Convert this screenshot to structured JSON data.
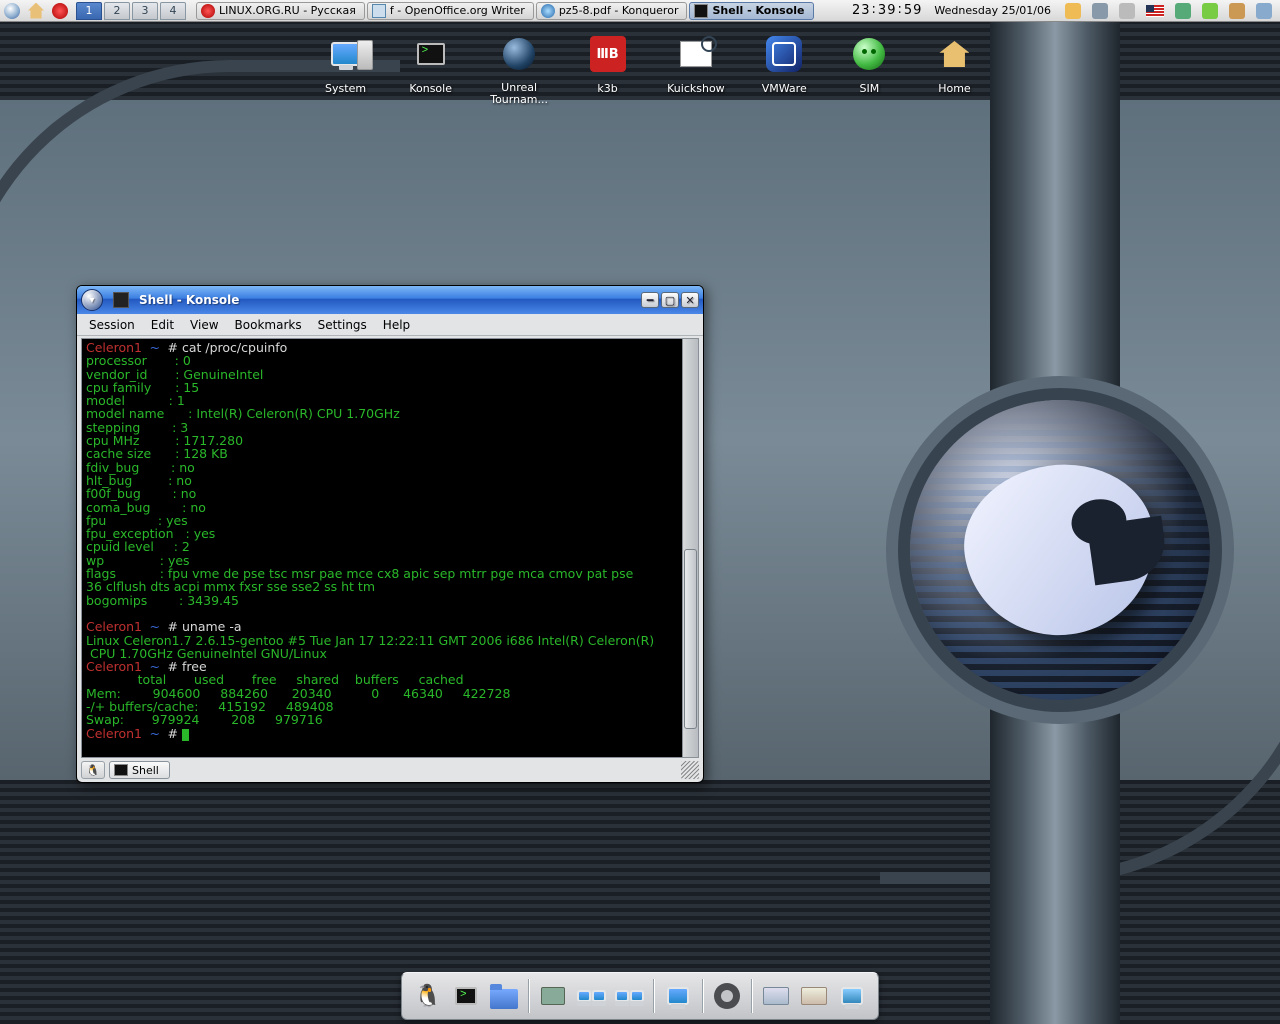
{
  "taskbar": {
    "desktops": [
      "1",
      "2",
      "3",
      "4"
    ],
    "active_desktop": 0,
    "tasks": [
      {
        "label": "LINUX.ORG.RU - Русская",
        "icon": "opera-icon",
        "active": false
      },
      {
        "label": "f - OpenOffice.org Writer",
        "icon": "writer-icon",
        "active": false
      },
      {
        "label": "pz5-8.pdf - Konqueror",
        "icon": "konqueror-icon",
        "active": false
      },
      {
        "label": "Shell - Konsole",
        "icon": "konsole-icon",
        "active": true
      }
    ],
    "clock": {
      "h": "23",
      "m": "39",
      "s": "59"
    },
    "date": "Wednesday 25/01/06",
    "tray": [
      "klipper-icon",
      "volume-icon",
      "keyboard-icon",
      "flag-us-icon",
      "cpu-monitor-icon",
      "flower-icon",
      "kwallet-icon",
      "network-icon"
    ]
  },
  "desktop_icons": [
    {
      "id": "system",
      "label": "System",
      "icon": "system-icon"
    },
    {
      "id": "konsole",
      "label": "Konsole",
      "icon": "konsole-icon"
    },
    {
      "id": "unreal",
      "label": "Unreal Tournam...",
      "icon": "ut-icon",
      "wrap": true
    },
    {
      "id": "k3b",
      "label": "k3b",
      "icon": "k3b-icon"
    },
    {
      "id": "kuickshow",
      "label": "Kuickshow",
      "icon": "kuickshow-icon"
    },
    {
      "id": "vmware",
      "label": "VMWare",
      "icon": "vmware-icon"
    },
    {
      "id": "sim",
      "label": "SIM",
      "icon": "sim-icon"
    },
    {
      "id": "home",
      "label": "Home",
      "icon": "home-icon"
    }
  ],
  "konsole": {
    "title": "Shell - Konsole",
    "menus": [
      "Session",
      "Edit",
      "View",
      "Bookmarks",
      "Settings",
      "Help"
    ],
    "bottom_tab": "Shell",
    "term": {
      "host": "Celeron1",
      "cmd1": "cat /proc/cpuinfo",
      "cpuinfo": [
        "processor       : 0",
        "vendor_id       : GenuineIntel",
        "cpu family      : 15",
        "model           : 1",
        "model name      : Intel(R) Celeron(R) CPU 1.70GHz",
        "stepping        : 3",
        "cpu MHz         : 1717.280",
        "cache size      : 128 KB",
        "fdiv_bug        : no",
        "hlt_bug         : no",
        "f00f_bug        : no",
        "coma_bug        : no",
        "fpu             : yes",
        "fpu_exception   : yes",
        "cpuid level     : 2",
        "wp              : yes",
        "flags           : fpu vme de pse tsc msr pae mce cx8 apic sep mtrr pge mca cmov pat pse",
        "36 clflush dts acpi mmx fxsr sse sse2 ss ht tm",
        "bogomips        : 3439.45"
      ],
      "cmd2": "uname -a",
      "uname": "Linux Celeron1.7 2.6.15-gentoo #5 Tue Jan 17 12:22:11 GMT 2006 i686 Intel(R) Celeron(R)\n CPU 1.70GHz GenuineIntel GNU/Linux",
      "cmd3": "free",
      "free_hdr": "             total       used       free     shared    buffers     cached",
      "free_rows": [
        "Mem:        904600     884260      20340          0      46340     422728",
        "-/+ buffers/cache:     415192     489408",
        "Swap:       979924        208     979716"
      ]
    }
  },
  "dock": {
    "items": [
      "penguin-icon",
      "konsole-icon",
      "folder-icon",
      "hardware-icon",
      "display-pair-icon",
      "display-pair2-icon",
      "monitor-blue-icon",
      "gear-icon",
      "panel1-icon",
      "panel2-icon",
      "desktop-icon"
    ]
  }
}
